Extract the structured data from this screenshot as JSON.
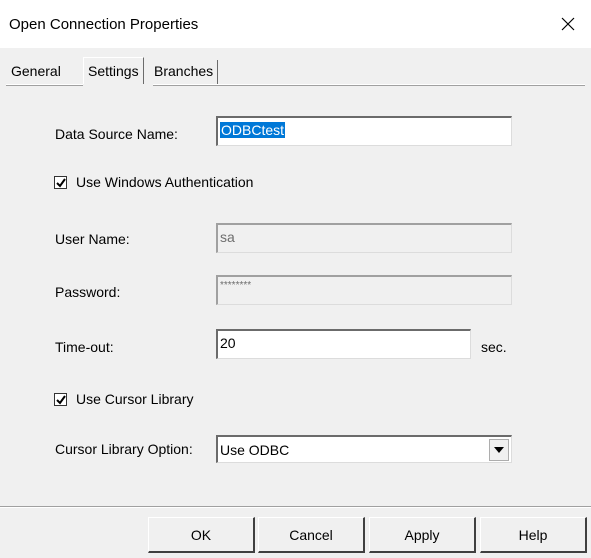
{
  "window": {
    "title": "Open Connection Properties",
    "close_glyph": "✕"
  },
  "tabs": [
    {
      "label": "General"
    },
    {
      "label": "Settings",
      "selected": true
    },
    {
      "label": "Branches"
    }
  ],
  "form": {
    "data_source_label": "Data Source Name:",
    "data_source_value": "ODBCtest",
    "use_windows_auth_label": "Use Windows Authentication",
    "use_windows_auth_checked": true,
    "user_name_label": "User Name:",
    "user_name_value": "sa",
    "password_label": "Password:",
    "password_value": "********",
    "timeout_label": "Time-out:",
    "timeout_value": "20",
    "timeout_unit": "sec.",
    "use_cursor_library_label": "Use Cursor Library",
    "use_cursor_library_checked": true,
    "cursor_option_label": "Cursor Library Option:",
    "cursor_option_value": "Use ODBC"
  },
  "buttons": {
    "ok": "OK",
    "cancel": "Cancel",
    "apply": "Apply",
    "help": "Help"
  },
  "icons": {
    "checkmark": "check-icon",
    "dropdown": "triangle-down-icon",
    "close": "close-icon"
  },
  "colors": {
    "selection": "#0078d7",
    "dialog_bg": "#f0f0f0"
  }
}
